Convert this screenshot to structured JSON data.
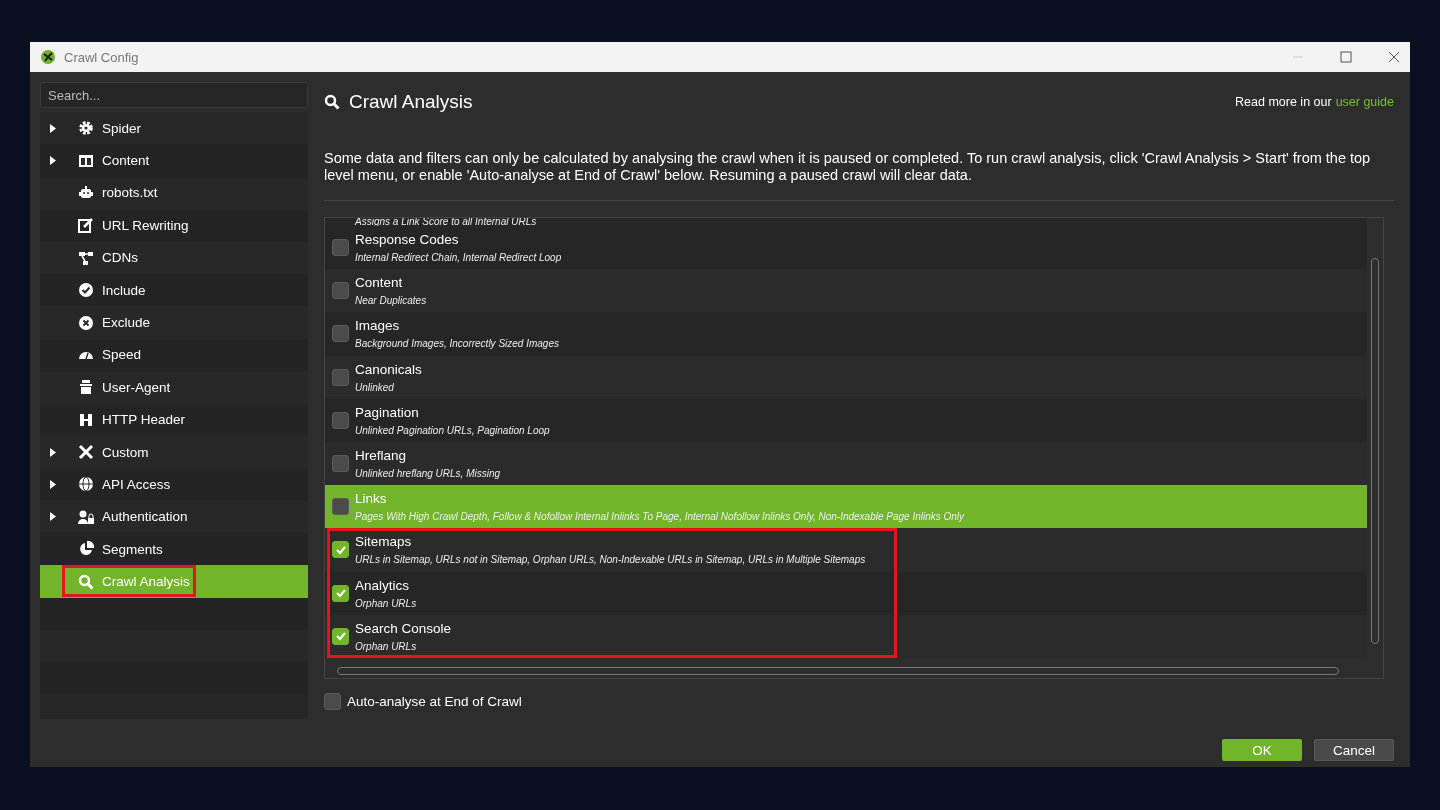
{
  "window": {
    "title": "Crawl Config"
  },
  "sidebar": {
    "search": {
      "placeholder": "Search..."
    },
    "items": [
      {
        "label": "Spider",
        "expandable": true,
        "selected": false,
        "highlighted": false
      },
      {
        "label": "Content",
        "expandable": true,
        "selected": false,
        "highlighted": false
      },
      {
        "label": "robots.txt",
        "expandable": false,
        "selected": false,
        "highlighted": false
      },
      {
        "label": "URL Rewriting",
        "expandable": false,
        "selected": false,
        "highlighted": false
      },
      {
        "label": "CDNs",
        "expandable": false,
        "selected": false,
        "highlighted": false
      },
      {
        "label": "Include",
        "expandable": false,
        "selected": false,
        "highlighted": false
      },
      {
        "label": "Exclude",
        "expandable": false,
        "selected": false,
        "highlighted": false
      },
      {
        "label": "Speed",
        "expandable": false,
        "selected": false,
        "highlighted": false
      },
      {
        "label": "User-Agent",
        "expandable": false,
        "selected": false,
        "highlighted": false
      },
      {
        "label": "HTTP Header",
        "expandable": false,
        "selected": false,
        "highlighted": false
      },
      {
        "label": "Custom",
        "expandable": true,
        "selected": false,
        "highlighted": false
      },
      {
        "label": "API Access",
        "expandable": true,
        "selected": false,
        "highlighted": false
      },
      {
        "label": "Authentication",
        "expandable": true,
        "selected": false,
        "highlighted": false
      },
      {
        "label": "Segments",
        "expandable": false,
        "selected": false,
        "highlighted": false
      },
      {
        "label": "Crawl Analysis",
        "expandable": false,
        "selected": true,
        "highlighted": true
      }
    ]
  },
  "panel": {
    "title": "Crawl Analysis",
    "guide_text": "Read more in our",
    "guide_link": "user guide",
    "description": "Some data and filters can only be calculated by analysing the crawl when it is paused or completed. To run crawl analysis, click 'Crawl Analysis > Start' from the top level menu, or enable 'Auto-analyse at End of Crawl' below. Resuming a paused crawl will clear data.",
    "cut_row_text": "Assigns a Link Score to all Internal URLs",
    "rows": [
      {
        "name": "Response Codes",
        "filters": "Internal Redirect Chain, Internal Redirect Loop",
        "checked": false,
        "selected": false,
        "highlighted": false
      },
      {
        "name": "Content",
        "filters": "Near Duplicates",
        "checked": false,
        "selected": false,
        "highlighted": false
      },
      {
        "name": "Images",
        "filters": "Background Images, Incorrectly Sized Images",
        "checked": false,
        "selected": false,
        "highlighted": false
      },
      {
        "name": "Canonicals",
        "filters": "Unlinked",
        "checked": false,
        "selected": false,
        "highlighted": false
      },
      {
        "name": "Pagination",
        "filters": "Unlinked Pagination URLs, Pagination Loop",
        "checked": false,
        "selected": false,
        "highlighted": false
      },
      {
        "name": "Hreflang",
        "filters": "Unlinked hreflang URLs, Missing",
        "checked": false,
        "selected": false,
        "highlighted": false
      },
      {
        "name": "Links",
        "filters": "Pages With High Crawl Depth, Follow & Nofollow Internal Inlinks To Page, Internal Nofollow Inlinks Only, Non-Indexable Page Inlinks Only",
        "checked": false,
        "selected": true,
        "highlighted": false
      },
      {
        "name": "Sitemaps",
        "filters": "URLs in Sitemap, URLs not in Sitemap, Orphan URLs, Non-Indexable URLs in Sitemap, URLs in Multiple Sitemaps",
        "checked": true,
        "selected": false,
        "highlighted": true
      },
      {
        "name": "Analytics",
        "filters": "Orphan URLs",
        "checked": true,
        "selected": false,
        "highlighted": true
      },
      {
        "name": "Search Console",
        "filters": "Orphan URLs",
        "checked": true,
        "selected": false,
        "highlighted": true
      }
    ],
    "auto_analyse": {
      "label": "Auto-analyse at End of Crawl",
      "checked": false
    }
  },
  "buttons": [
    {
      "label": "OK",
      "kind": "primary"
    },
    {
      "label": "Cancel",
      "kind": "secondary"
    }
  ]
}
